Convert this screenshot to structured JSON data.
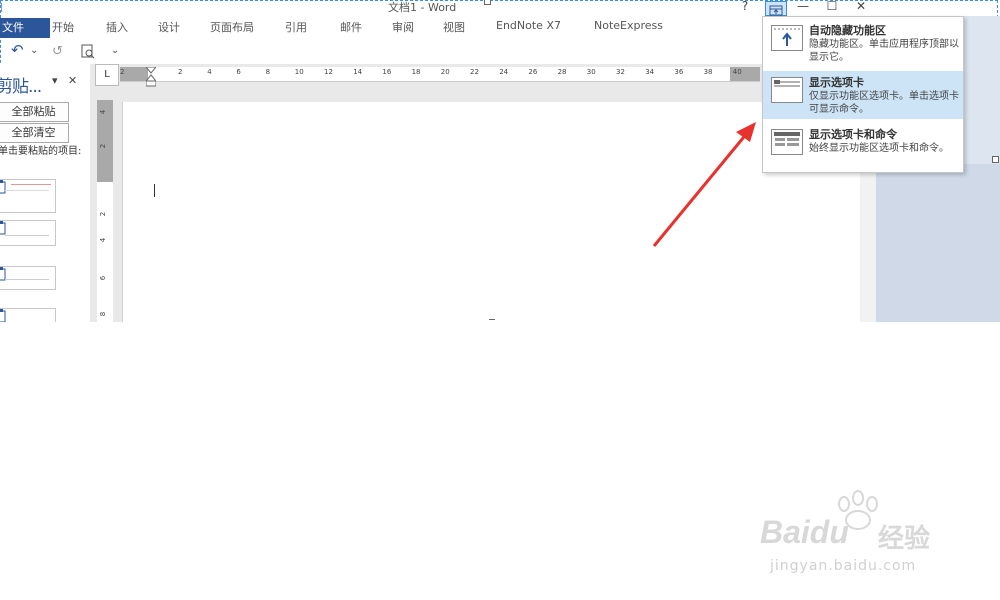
{
  "window": {
    "title": "文档1 - Word",
    "help": "?",
    "minimize": "—",
    "maximize": "☐",
    "close": "✕"
  },
  "tabs": {
    "file": "文件",
    "items": [
      "开始",
      "插入",
      "设计",
      "页面布局",
      "引用",
      "邮件",
      "审阅",
      "视图",
      "EndNote X7",
      "NoteExpress"
    ]
  },
  "qat": {
    "undo": "↶",
    "undo_dropdown": "⌄",
    "redo": "↺",
    "customize": "⌄"
  },
  "clipboard": {
    "title": "剪贴...",
    "dropdown": "▾",
    "close": "✕",
    "paste_all": "全部粘贴",
    "clear_all": "全部清空",
    "hint": "单击要粘贴的项目:"
  },
  "ruler": {
    "corner": "L",
    "h_numbers": [
      "2",
      "2",
      "4",
      "6",
      "8",
      "10",
      "12",
      "14",
      "16",
      "18",
      "20",
      "22",
      "24",
      "26",
      "28",
      "30",
      "32",
      "34",
      "36",
      "38",
      "40"
    ],
    "v_numbers": [
      "4",
      "2",
      "2",
      "4",
      "6",
      "8"
    ]
  },
  "ribbon_menu": {
    "options": [
      {
        "icon": "auto-hide-ribbon-icon",
        "title": "自动隐藏功能区",
        "desc": "隐藏功能区。单击应用程序顶部以显示它。"
      },
      {
        "icon": "show-tabs-icon",
        "title": "显示选项卡",
        "desc": "仅显示功能区选项卡。单击选项卡可显示命令。"
      },
      {
        "icon": "show-tabs-commands-icon",
        "title": "显示选项卡和命令",
        "desc": "始终显示功能区选项卡和命令。"
      }
    ]
  },
  "watermark": {
    "brand": "Baidu",
    "brand_cn": "经验",
    "url": "jingyan.baidu.com"
  },
  "colors": {
    "file_tab": "#2b579a",
    "arrow": "#e8322f",
    "popup_hover": "#cde4f7"
  }
}
